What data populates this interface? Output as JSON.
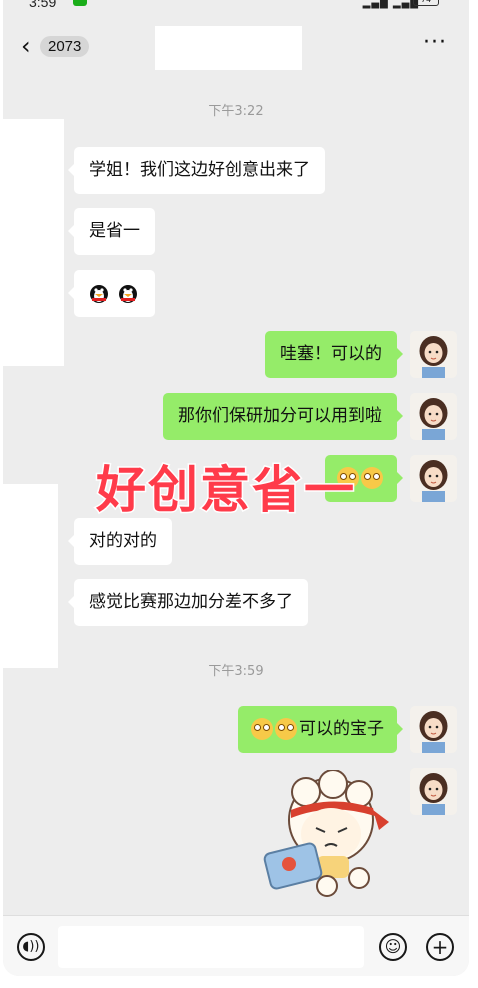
{
  "status_bar": {
    "time": "3:59",
    "battery": "74"
  },
  "header": {
    "back_count": "2073",
    "more_label": "···"
  },
  "timestamps": [
    "下午3:22",
    "下午3:59"
  ],
  "messages": [
    {
      "side": "left",
      "text": "学姐！我们这边好创意出来了"
    },
    {
      "side": "left",
      "text": "是省一"
    },
    {
      "side": "left",
      "emoji": "penguin x2"
    },
    {
      "side": "right",
      "text": "哇塞！可以的"
    },
    {
      "side": "right",
      "text": "那你们保研加分可以用到啦"
    },
    {
      "side": "right",
      "emoji": "smile x2"
    },
    {
      "side": "left",
      "text": "对的对的"
    },
    {
      "side": "left",
      "text": "感觉比赛那边加分差不多了"
    },
    {
      "side": "right",
      "text": "可以的宝子",
      "emoji": "smile x2"
    },
    {
      "side": "right",
      "sticker": "sheep-with-tablet-sticker"
    }
  ],
  "overlay": {
    "text": "好创意省一"
  },
  "colors": {
    "bg": "#ededed",
    "right_bubble": "#95ec69",
    "left_bubble": "#ffffff",
    "overlay": "#ff3b4a"
  },
  "icons": {
    "voice": "voice-icon",
    "emoji": "emoji-icon",
    "add": "plus-icon"
  }
}
